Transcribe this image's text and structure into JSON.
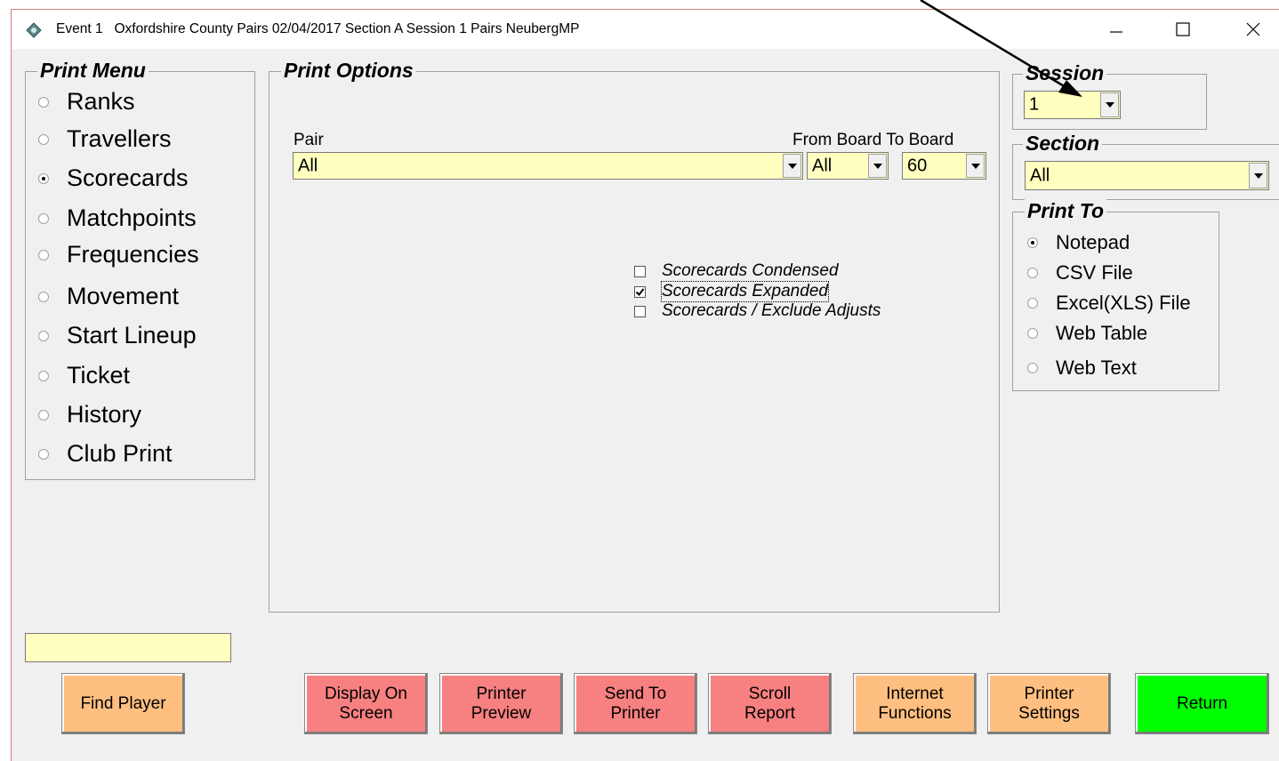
{
  "window": {
    "title": "Event 1   Oxfordshire County Pairs 02/04/2017 Section A Session 1 Pairs NeubergMP",
    "icons": [
      "app-icon",
      "minimize-icon",
      "maximize-icon",
      "close-icon"
    ]
  },
  "print_menu": {
    "title": "Print Menu",
    "selected": "Scorecards",
    "items": [
      "Ranks",
      "Travellers",
      "Scorecards",
      "Matchpoints",
      "Frequencies",
      "Movement",
      "Start Lineup",
      "Ticket",
      "History",
      "Club Print"
    ]
  },
  "print_options": {
    "title": "Print Options",
    "pair_label": "Pair",
    "pair_value": "All",
    "board_label": "From Board To Board",
    "from_board_value": "All",
    "to_board_value": "60",
    "checkboxes": [
      {
        "label": "Scorecards Condensed",
        "checked": false
      },
      {
        "label": "Scorecards Expanded",
        "checked": true
      },
      {
        "label": "Scorecards / Exclude Adjusts",
        "checked": false
      }
    ]
  },
  "session": {
    "title": "Session",
    "value": "1"
  },
  "section": {
    "title": "Section",
    "value": "All"
  },
  "print_to": {
    "title": "Print To",
    "selected": "Notepad",
    "items": [
      "Notepad",
      "CSV File",
      "Excel(XLS) File",
      "Web Table",
      "Web Text"
    ]
  },
  "find_player": {
    "input_value": "",
    "button_label": "Find Player"
  },
  "buttons": {
    "display_on_screen": "Display On\nScreen",
    "printer_preview": "Printer\nPreview",
    "send_to_printer": "Send To\nPrinter",
    "scroll_report": "Scroll\nReport",
    "internet_functions": "Internet\nFunctions",
    "printer_settings": "Printer\nSettings",
    "return": "Return"
  },
  "colors": {
    "input_bg": "#ffffc0",
    "red_button": "#f78080",
    "orange_button": "#ffbf80",
    "green_button": "#00ff00"
  },
  "annotation": {
    "arrow": "pointer-arrow-to-session-dropdown"
  }
}
